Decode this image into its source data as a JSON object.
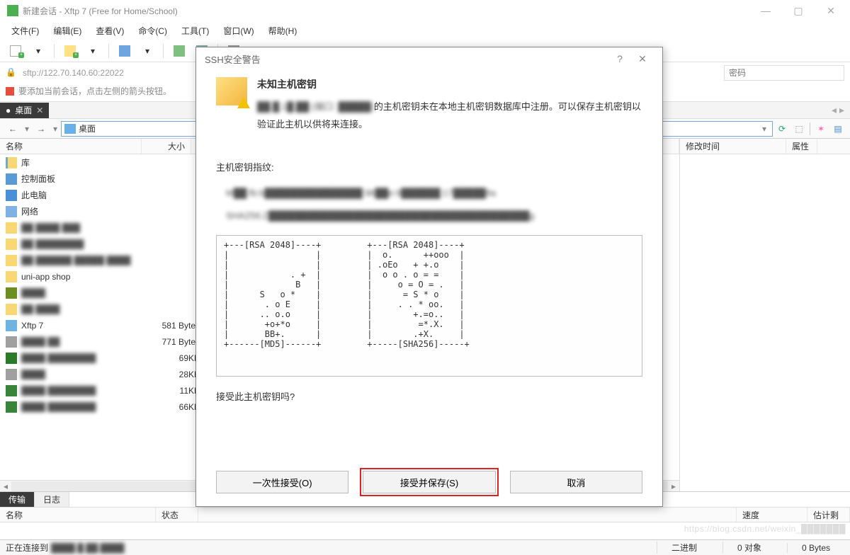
{
  "title": "新建会话 - Xftp 7 (Free for Home/School)",
  "menus": [
    "文件(F)",
    "编辑(E)",
    "查看(V)",
    "命令(C)",
    "工具(T)",
    "窗口(W)",
    "帮助(H)"
  ],
  "address": "sftp://122.70.140.60:22022",
  "hint": "要添加当前会话，点击左侧的箭头按钮。",
  "password_placeholder": "密码",
  "tab": "桌面",
  "path_label": "桌面",
  "columns_left": {
    "name": "名称",
    "size": "大小"
  },
  "columns_right": {
    "mtime": "修改时间",
    "attr": "属性"
  },
  "files": [
    {
      "name": "库",
      "size": "",
      "icon": "lib"
    },
    {
      "name": "控制面板",
      "size": "",
      "icon": "panel"
    },
    {
      "name": "此电脑",
      "size": "",
      "icon": "pc"
    },
    {
      "name": "网络",
      "size": "",
      "icon": "net"
    },
    {
      "name": "██ ████ ███",
      "size": "",
      "icon": "folder",
      "blur": true
    },
    {
      "name": "██ ████████",
      "size": "",
      "icon": "folder",
      "blur": true
    },
    {
      "name": "██ ██████ █████ ████",
      "size": "",
      "icon": "folder",
      "blur": true
    },
    {
      "name": "uni-app shop",
      "size": "",
      "icon": "folder"
    },
    {
      "name": "████",
      "size": "",
      "icon": "user",
      "blur": true
    },
    {
      "name": "██ ████",
      "size": "",
      "icon": "folder",
      "blur": true
    },
    {
      "name": "Xftp 7",
      "size": "581 Bytes",
      "icon": "app"
    },
    {
      "name": "████ ██",
      "size": "771 Bytes",
      "icon": "file",
      "blur": true
    },
    {
      "name": "████ ████████",
      "size": "69KB",
      "icon": "xdoc",
      "blur": true
    },
    {
      "name": "████",
      "size": "28KB",
      "icon": "file",
      "blur": true
    },
    {
      "name": "████ ████████",
      "size": "11KB",
      "icon": "doc",
      "blur": true
    },
    {
      "name": "████ ████████",
      "size": "66KB",
      "icon": "doc",
      "blur": true
    }
  ],
  "lower_tabs": {
    "transfer": "传输",
    "log": "日志"
  },
  "transfer_cols": {
    "name": "名称",
    "state": "状态",
    "speed": "速度",
    "est": "估计剩"
  },
  "status": {
    "connecting": "正在连接到",
    "target": "████.█.██.████",
    "binary": "二进制",
    "objects": "0 对象",
    "bytes": "0 Bytes"
  },
  "dialog": {
    "title": "SSH安全警告",
    "heading": "未知主机密钥",
    "msg_before": "██.█.1█.██ (端口: █████)",
    "msg_after": "的主机密钥未在本地主机密钥数据库中注册。可以保存主机密钥以验证此主机以供将来连接。",
    "fp_label": "主机密钥指纹:",
    "md5": "M██:fb:b███████████████:98██e:9██████:17█████8a",
    "sha256": "SHA256:Z████████████████████████████████████████g",
    "ascii": "+---[RSA 2048]----+         +---[RSA 2048]----+\n|                 |         |  o.      ++ooo  |\n|                 |         | .oEo   + +.o    |\n|            . +  |         |  o o . o = =    |\n|             B   |         |     o = O = .   |\n|      S   o *    |         |      = S * o    |\n|       . o E     |         |     . . * oo.   |\n|      .. o.o     |         |        +.=o..   |\n|       +o+*o     |         |         =*.X.   |\n|       BB+.      |         |        .+X.     |\n+------[MD5]------+         +-----[SHA256]-----+",
    "question": "接受此主机密钥吗?",
    "btn_once": "一次性接受(O)",
    "btn_save": "接受并保存(S)",
    "btn_cancel": "取消"
  },
  "watermark": "https://blog.csdn.net/weixin_███████"
}
